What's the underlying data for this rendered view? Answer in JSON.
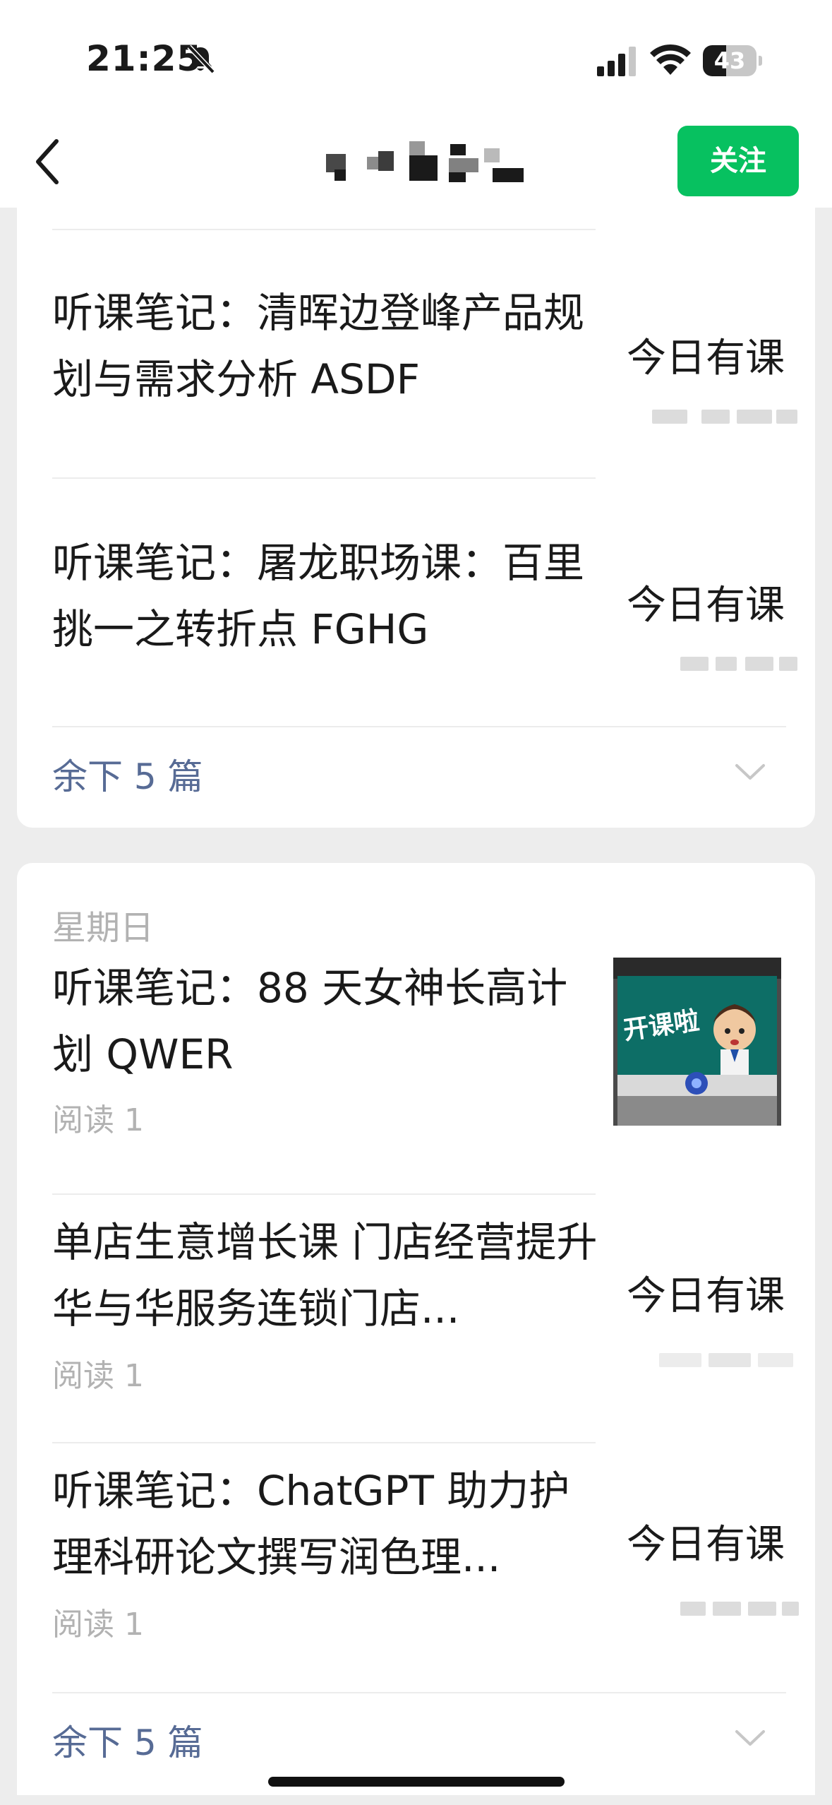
{
  "status_bar": {
    "time": "21:25",
    "battery_level": "43"
  },
  "nav": {
    "follow_label": "关注"
  },
  "card1": {
    "items": [
      {
        "title": "听课笔记：清晖边登峰产品规划与需求分析 ASDF",
        "thumb_text": "今日有课"
      },
      {
        "title": "听课笔记：屠龙职场课：百里挑一之转折点 FGHG",
        "thumb_text": "今日有课"
      }
    ],
    "more_label": "余下 5 篇"
  },
  "card2": {
    "day_label": "星期日",
    "items": [
      {
        "title": "听课笔记：88 天女神长高计划 QWER",
        "meta": "阅读 1",
        "thumb_image_text": "开课啦"
      },
      {
        "title": "单店生意增长课 门店经营提升华与华服务连锁门店...",
        "meta": "阅读 1",
        "thumb_text": "今日有课"
      },
      {
        "title": "听课笔记：ChatGPT 助力护理科研论文撰写润色理...",
        "meta": "阅读 1",
        "thumb_text": "今日有课"
      }
    ],
    "more_label": "余下 5 篇"
  },
  "colors": {
    "accent_green": "#07c160",
    "link_blue": "#576b95",
    "background": "#ededed"
  }
}
